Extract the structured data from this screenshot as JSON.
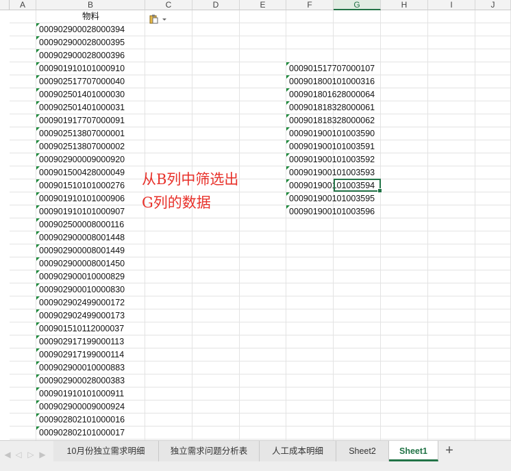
{
  "columns": [
    "A",
    "B",
    "C",
    "D",
    "E",
    "F",
    "G",
    "H",
    "I",
    "J"
  ],
  "selected_column": "G",
  "header_b": "物料",
  "column_b_values": [
    "000902900028000394",
    "000902900028000395",
    "000902900028000396",
    "000901910101000910",
    "000902517707000040",
    "000902501401000030",
    "000902501401000031",
    "000901917707000091",
    "000902513807000001",
    "000902513807000002",
    "000902900009000920",
    "000901500428000049",
    "000901510101000276",
    "000901910101000906",
    "000901910101000907",
    "000902500008000116",
    "000902900008001448",
    "000902900008001449",
    "000902900008001450",
    "000902900010000829",
    "000902900010000830",
    "000902902499000172",
    "000902902499000173",
    "000901510112000037",
    "000902917199000113",
    "000902917199000114",
    "000902900010000883",
    "000902900028000383",
    "000901910101000911",
    "000902900009000924",
    "000902802101000016",
    "000902802101000017"
  ],
  "column_f_values": [
    "000901517707000107",
    "000901800101000316",
    "000901801628000064",
    "000901818328000061",
    "000901818328000062",
    "000901900101003590",
    "000901900101003591",
    "000901900101003592",
    "000901900101003593",
    "000901900101003594",
    "000901900101003595",
    "000901900101003596"
  ],
  "annotation": {
    "line1": "从B列中筛选出",
    "line2": "G列的数据",
    "color": "#e8312a"
  },
  "sheet_tabs": [
    "10月份独立需求明细",
    "独立需求问题分析表",
    "人工成本明细",
    "Sheet2",
    "Sheet1"
  ],
  "active_tab": "Sheet1",
  "colors": {
    "accent": "#217346",
    "marker": "#1e8a3c"
  }
}
